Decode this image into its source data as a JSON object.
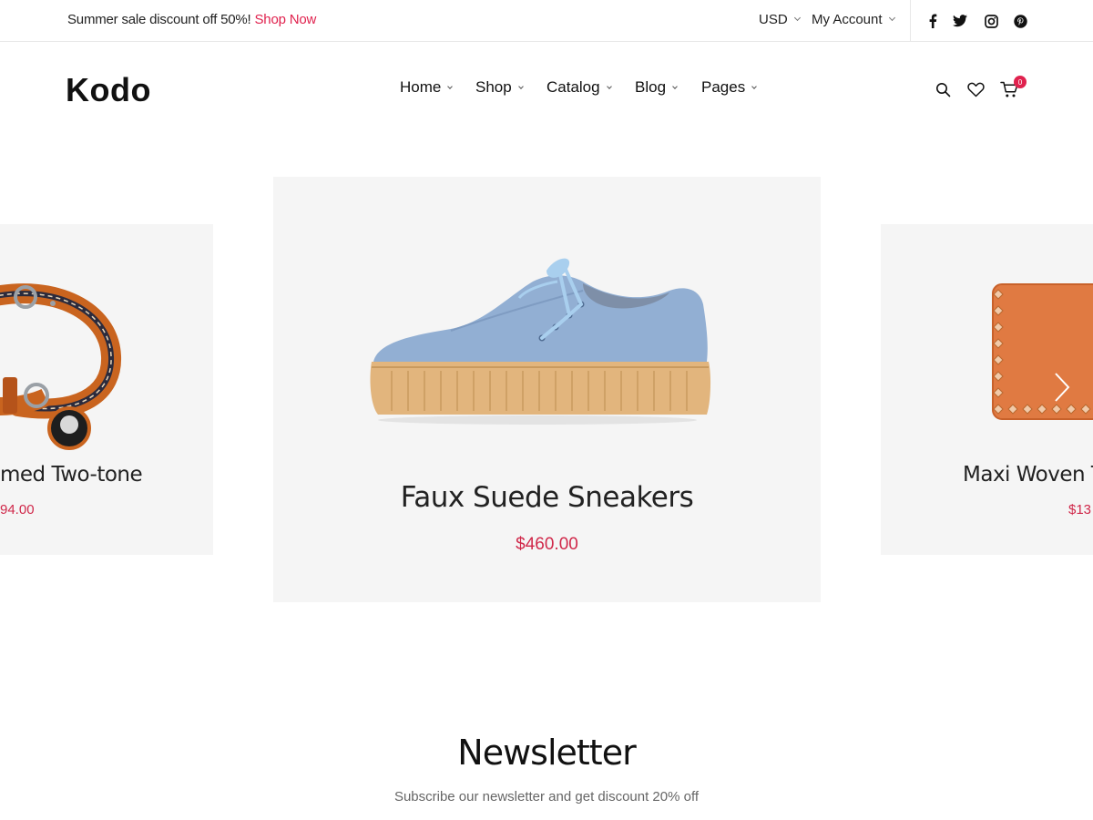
{
  "topbar": {
    "promo_text": "Summer sale discount off 50%!",
    "promo_link": "Shop Now",
    "currency": "USD",
    "account": "My Account",
    "social": [
      "facebook-icon",
      "twitter-icon",
      "instagram-icon",
      "pinterest-icon"
    ]
  },
  "header": {
    "logo": "Kodo",
    "nav": [
      "Home",
      "Shop",
      "Catalog",
      "Blog",
      "Pages"
    ],
    "cart_count": "0"
  },
  "carousel": {
    "left": {
      "name": "med Two-tone",
      "price": "94.00"
    },
    "center": {
      "name": "Faux Suede Sneakers",
      "price": "$460.00"
    },
    "right": {
      "name": "Maxi Woven T",
      "price": "$13"
    }
  },
  "newsletter": {
    "title": "Newsletter",
    "subtitle": "Subscribe our newsletter and get discount 20% off"
  },
  "colors": {
    "accent": "#e0224e",
    "price": "#d0284a",
    "card_bg": "#f5f5f5"
  }
}
